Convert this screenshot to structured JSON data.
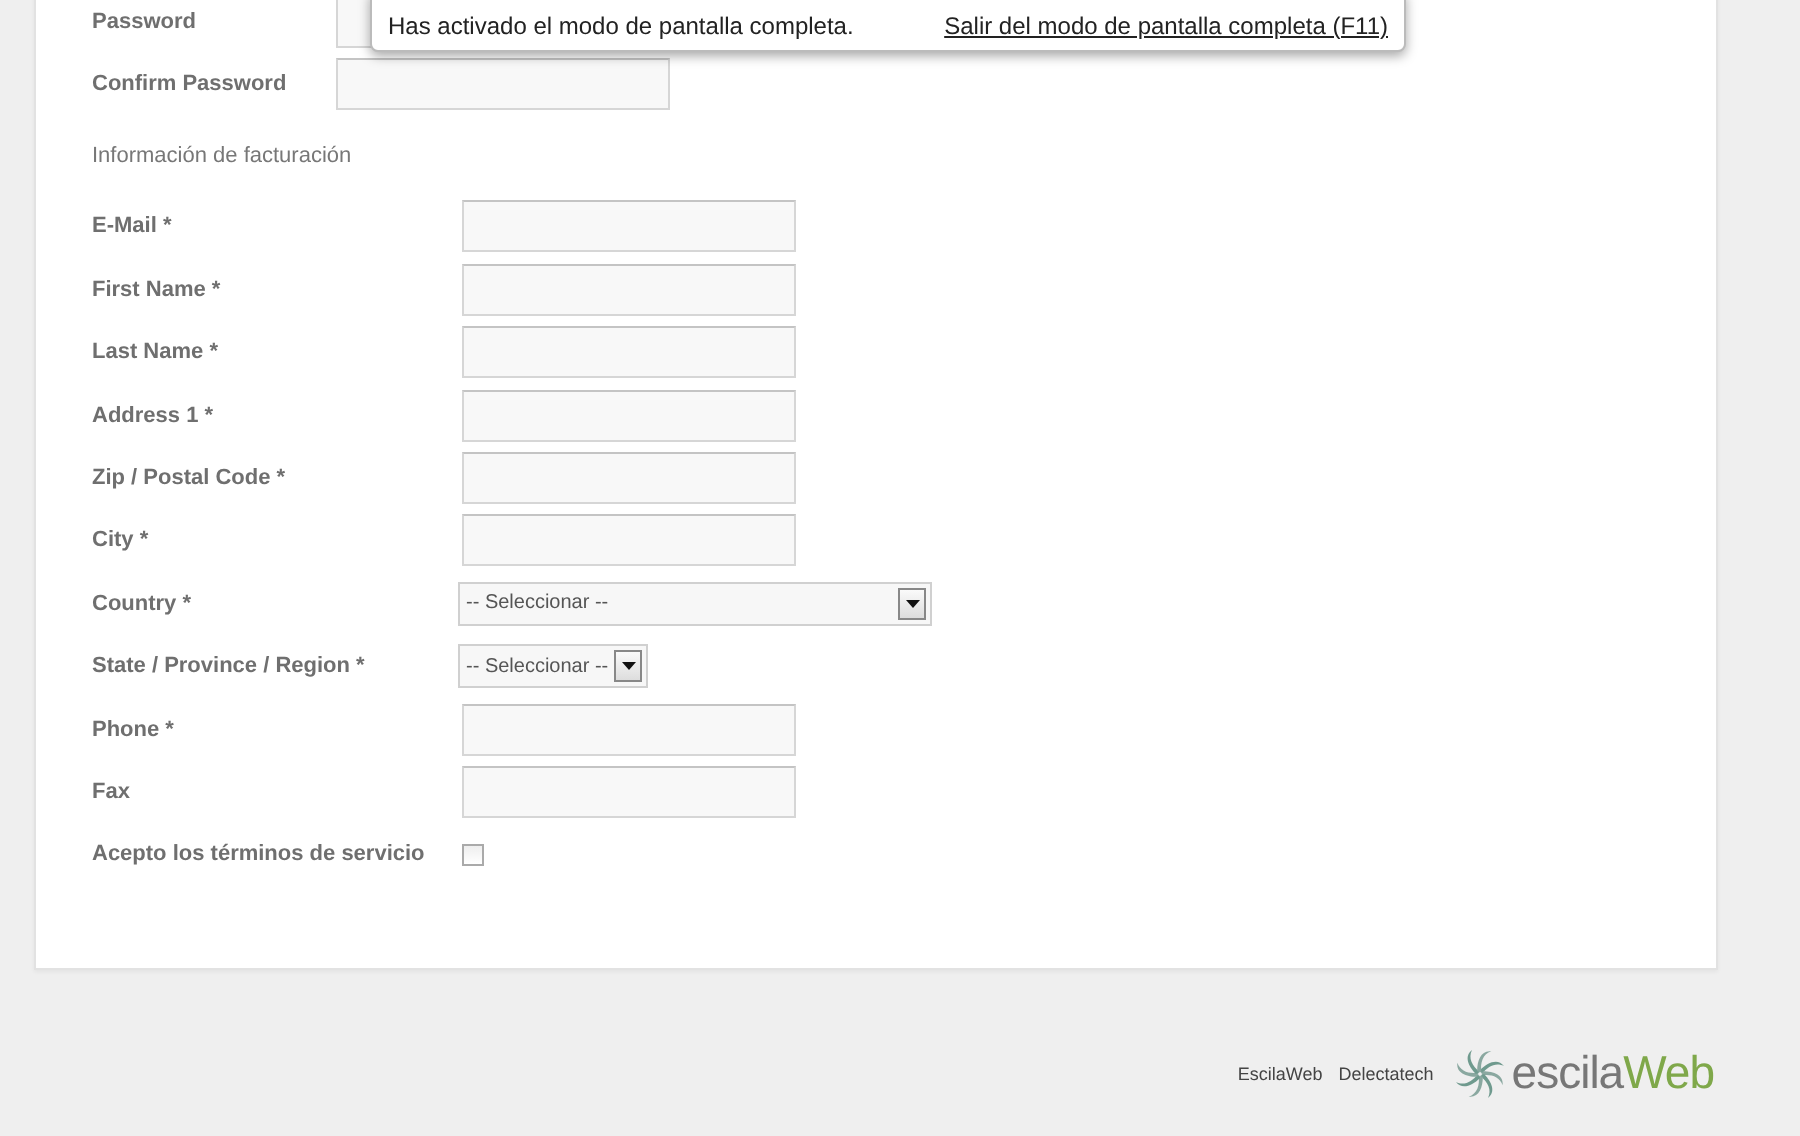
{
  "notification": {
    "message": "Has activado el modo de pantalla completa.",
    "link": "Salir del modo de pantalla completa (F11)"
  },
  "account_fields": [
    {
      "label": "Password",
      "kind": "password"
    },
    {
      "label": "Confirm Password",
      "kind": "password"
    }
  ],
  "billing": {
    "heading": "Información de facturación",
    "fields": [
      {
        "label": "E-Mail *",
        "kind": "text"
      },
      {
        "label": "First Name *",
        "kind": "text"
      },
      {
        "label": "Last Name *",
        "kind": "text"
      },
      {
        "label": "Address 1 *",
        "kind": "text"
      },
      {
        "label": "Zip / Postal Code *",
        "kind": "text"
      },
      {
        "label": "City *",
        "kind": "text"
      },
      {
        "label": "Country *",
        "kind": "select",
        "value": "-- Seleccionar --",
        "wide": true
      },
      {
        "label": "State / Province / Region *",
        "kind": "select",
        "value": "-- Seleccionar --",
        "wide": false
      },
      {
        "label": "Phone *",
        "kind": "text"
      },
      {
        "label": "Fax",
        "kind": "text"
      },
      {
        "label": "Acepto los términos de servicio",
        "kind": "checkbox",
        "checked": false
      }
    ]
  },
  "footer": {
    "links": [
      "EscilaWeb",
      "Delectatech"
    ],
    "logo": {
      "text_1": "escila",
      "text_2": "Web"
    }
  }
}
